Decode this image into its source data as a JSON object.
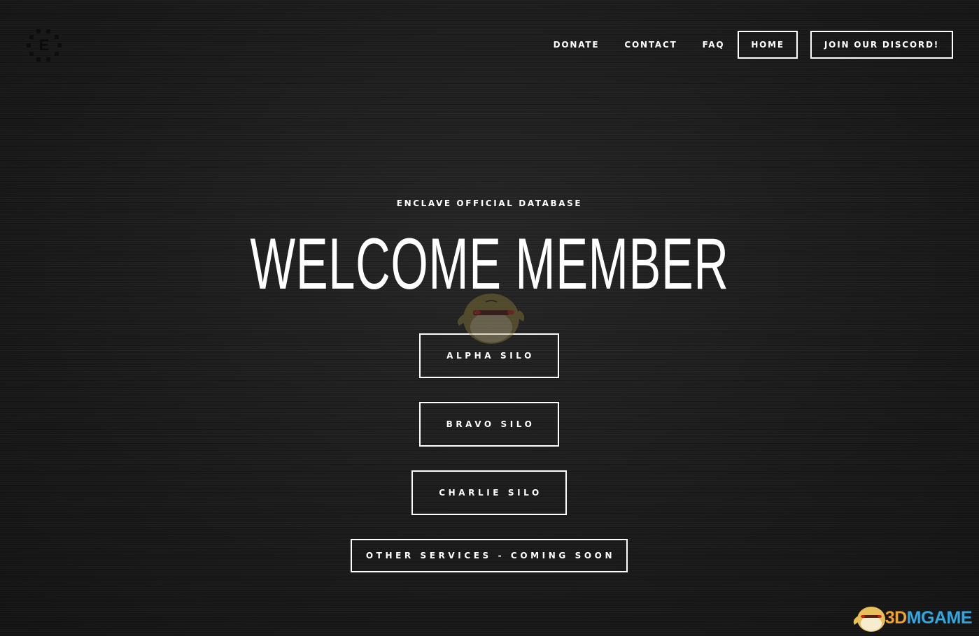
{
  "header": {
    "logo_letter": "E",
    "nav": {
      "donate": "DONATE",
      "contact": "CONTACT",
      "faq": "FAQ",
      "home": "HOME",
      "discord": "JOIN OUR DISCORD!"
    }
  },
  "hero": {
    "eyebrow": "ENCLAVE OFFICIAL DATABASE",
    "title": "WELCOME MEMBER",
    "buttons": {
      "alpha": "ALPHA SILO",
      "bravo": "BRAVO SILO",
      "charlie": "CHARLIE SILO",
      "other": "OTHER SERVICES - COMING SOON"
    }
  },
  "watermark": {
    "num": "3D",
    "rest": "MGAME"
  },
  "icons": {
    "logo": "enclave-logo-icon",
    "mascot": "mascot-watermark-icon"
  },
  "colors": {
    "background": "#1c1c1c",
    "text": "#ffffff",
    "watermark_orange": "#f0a12a",
    "watermark_blue": "#2fa7e0"
  }
}
